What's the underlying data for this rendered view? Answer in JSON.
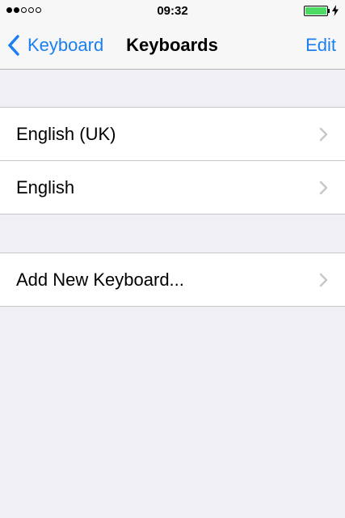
{
  "status_bar": {
    "signal_dots_filled": 2,
    "signal_dots_total": 5,
    "time": "09:32",
    "battery_level": 1.0,
    "battery_icon": "battery-icon",
    "charging_icon": "lightning-bolt-icon"
  },
  "nav": {
    "back_label": "Keyboard",
    "back_icon": "chevron-left-icon",
    "title": "Keyboards",
    "edit_label": "Edit"
  },
  "keyboards": [
    {
      "label": "English (UK)",
      "icon": "chevron-right-icon"
    },
    {
      "label": "English",
      "icon": "chevron-right-icon"
    }
  ],
  "add_keyboard": {
    "label": "Add New Keyboard...",
    "icon": "chevron-right-icon"
  },
  "colors": {
    "accent": "#1a7ff0",
    "background": "#efeff4",
    "battery": "#4cd964",
    "chevron": "#c7c7cc"
  }
}
